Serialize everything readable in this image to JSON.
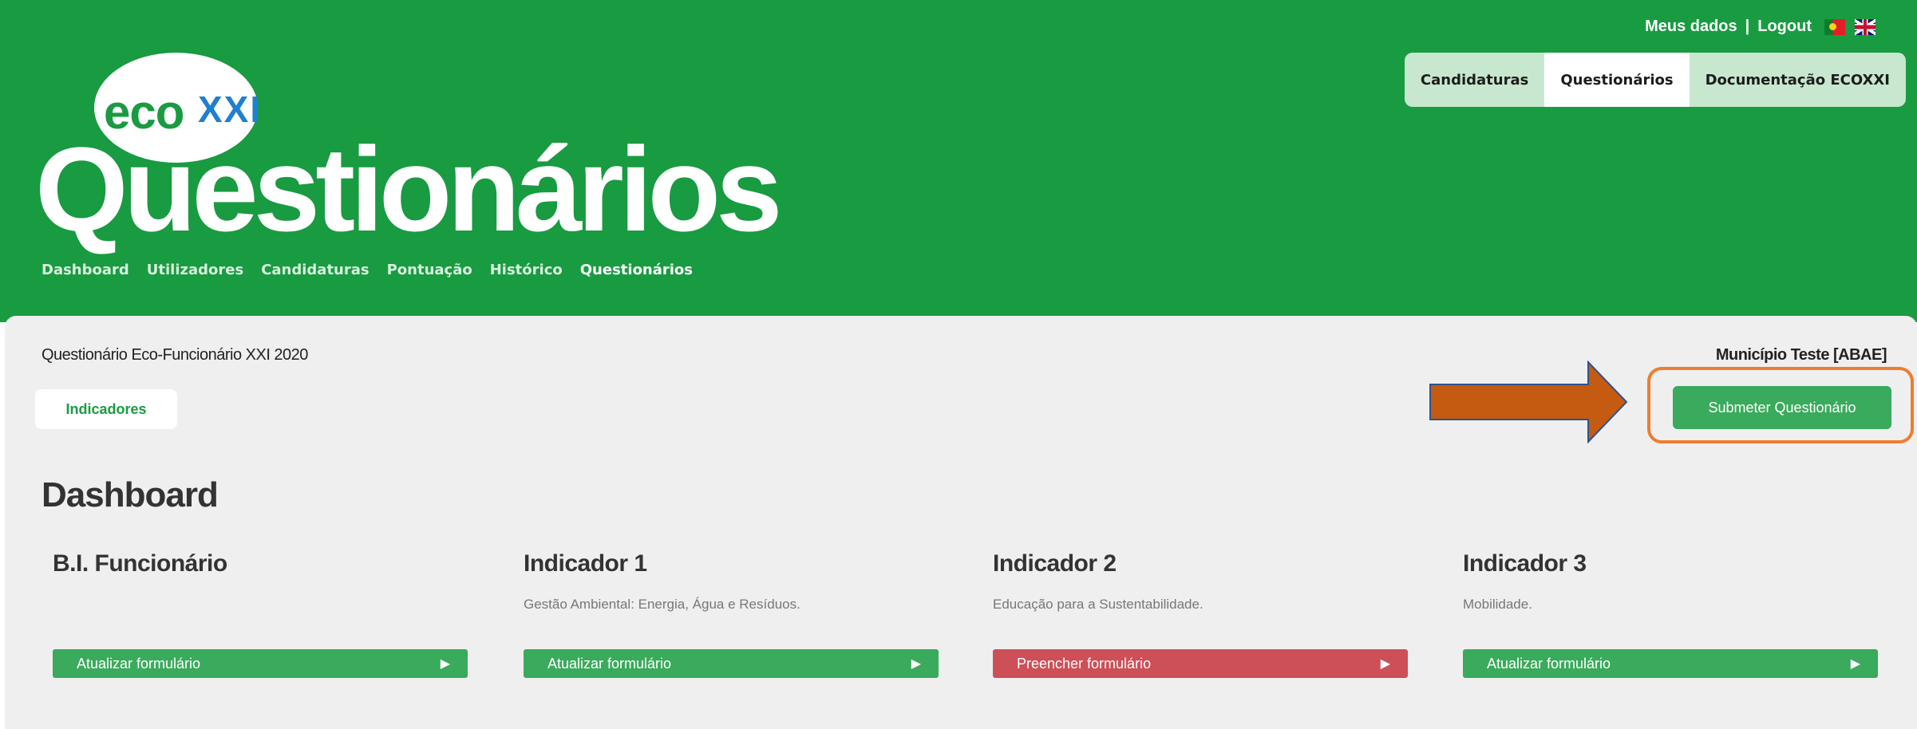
{
  "header": {
    "user_links": {
      "my_data": "Meus dados",
      "separator": "|",
      "logout": "Logout"
    },
    "languages": [
      "pt-flag-icon",
      "uk-flag-icon"
    ],
    "top_tabs": [
      {
        "label": "Candidaturas",
        "active": false
      },
      {
        "label": "Questionários",
        "active": true
      },
      {
        "label": "Documentação ECOXXI",
        "active": false
      }
    ],
    "logo": {
      "eco": "eco",
      "xxi": "XXI"
    },
    "page_title": "Questionários",
    "main_nav": [
      {
        "label": "Dashboard",
        "active": false
      },
      {
        "label": "Utilizadores",
        "active": false
      },
      {
        "label": "Candidaturas",
        "active": false
      },
      {
        "label": "Pontuação",
        "active": false
      },
      {
        "label": "Histórico",
        "active": false
      },
      {
        "label": "Questionários",
        "active": true
      }
    ]
  },
  "content": {
    "questionnaire_title": "Questionário Eco-Funcionário XXI 2020",
    "municipality": "Município Teste [ABAE]",
    "sub_tab": "Indicadores",
    "submit_label": "Submeter Questionário",
    "dashboard_title": "Dashboard",
    "cards": [
      {
        "title": "B.I. Funcionário",
        "description": "",
        "button": "Atualizar formulário",
        "status": "green"
      },
      {
        "title": "Indicador 1",
        "description": "Gestão Ambiental: Energia, Água e Resíduos.",
        "button": "Atualizar formulário",
        "status": "green"
      },
      {
        "title": "Indicador 2",
        "description": "Educação para a Sustentabilidade.",
        "button": "Preencher formulário",
        "status": "red"
      },
      {
        "title": "Indicador 3",
        "description": "Mobilidade.",
        "button": "Atualizar formulário",
        "status": "green"
      }
    ]
  },
  "colors": {
    "brand_green": "#199b41",
    "button_green": "#3aaa5c",
    "button_red": "#cd4f57",
    "annotation_orange": "#c55a11",
    "annotation_border": "#ed7d31"
  }
}
